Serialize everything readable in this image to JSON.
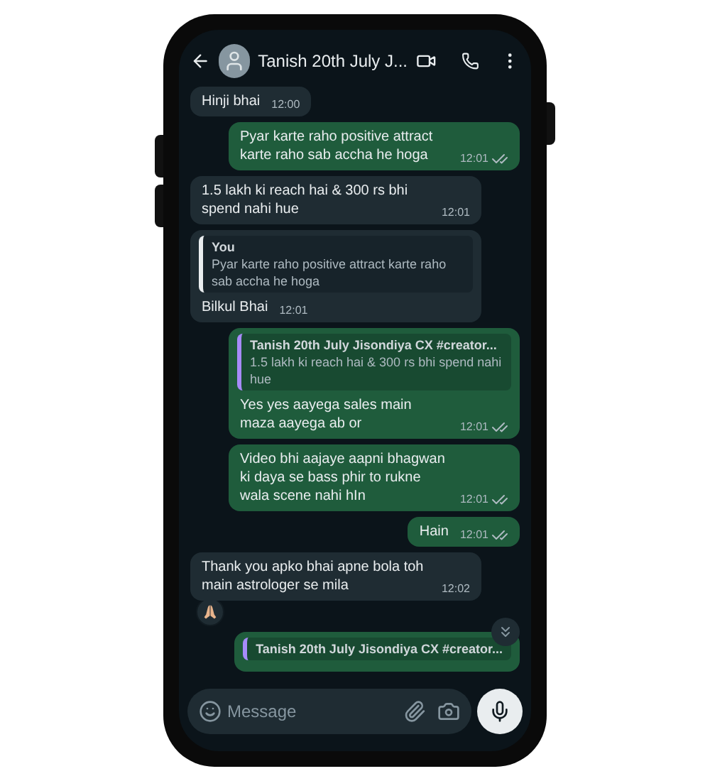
{
  "header": {
    "title": "Tanish 20th July J..."
  },
  "messages": [
    {
      "kind": "in",
      "text": "Hinji bhai",
      "time": "12:00"
    },
    {
      "kind": "out",
      "text": "Pyar karte raho positive attract karte raho sab accha he hoga",
      "time": "12:01",
      "read": true
    },
    {
      "kind": "in",
      "text": "1.5 lakh ki reach hai & 300 rs bhi spend nahi hue",
      "time": "12:01"
    },
    {
      "kind": "in",
      "quote": {
        "author": "You",
        "text": "Pyar karte raho positive attract karte raho sab accha he hoga"
      },
      "text": "Bilkul Bhai",
      "time": "12:01"
    },
    {
      "kind": "out",
      "quote": {
        "author": "Tanish 20th July Jisondiya CX #creator...",
        "text": "1.5 lakh ki reach hai & 300 rs bhi spend nahi hue"
      },
      "text": "Yes yes aayega sales main maza aayega ab or",
      "time": "12:01",
      "read": true
    },
    {
      "kind": "out",
      "text": "Video bhi aajaye aapni bhagwan ki daya se bass phir to rukne wala scene nahi hIn",
      "time": "12:01",
      "read": true
    },
    {
      "kind": "out",
      "text": "Hain",
      "time": "12:01",
      "read": true
    },
    {
      "kind": "in",
      "text": "Thank you apko bhai apne bola toh main astrologer se mila",
      "time": "12:02",
      "reaction": true
    },
    {
      "kind": "out",
      "quote": {
        "author": "Tanish 20th July Jisondiya CX #creator..."
      }
    }
  ],
  "composer": {
    "placeholder": "Message"
  }
}
